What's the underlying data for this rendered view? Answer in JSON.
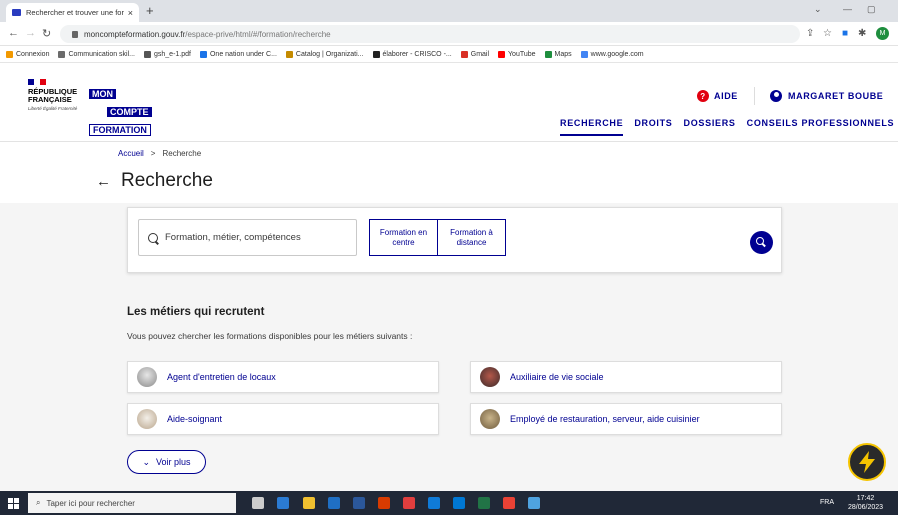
{
  "browser": {
    "tab_title": "Rechercher et trouver une forma",
    "tab_close": "×",
    "new_tab": "+",
    "url_host": "moncompteformation.gouv.fr",
    "url_path": "/espace-prive/html/#/formation/recherche",
    "profile_initial": "M",
    "bookmarks": [
      {
        "label": "Connexion",
        "color": "#f29900"
      },
      {
        "label": "Communication skil...",
        "color": "#6b6b6b"
      },
      {
        "label": "gsh_e-1.pdf",
        "color": "#555555"
      },
      {
        "label": "One nation under C...",
        "color": "#1a73e8"
      },
      {
        "label": "Catalog | Organizati...",
        "color": "#c58b00"
      },
      {
        "label": "élaborer - CRISCO -...",
        "color": "#222222"
      },
      {
        "label": "Gmail",
        "color": "#d93025"
      },
      {
        "label": "YouTube",
        "color": "#ff0000"
      },
      {
        "label": "Maps",
        "color": "#1e8e3e"
      },
      {
        "label": "www.google.com",
        "color": "#4285f4"
      }
    ]
  },
  "header": {
    "rf_line1": "RÉPUBLIQUE",
    "rf_line2": "FRANÇAISE",
    "rf_motto": "Liberté Égalité Fraternité",
    "mcf_line1": "MON",
    "mcf_line2": "COMPTE",
    "mcf_line3": "FORMATION",
    "aide_label": "AIDE",
    "user_label": "MARGARET BOUBE",
    "nav": [
      "RECHERCHE",
      "DROITS",
      "DOSSIERS",
      "CONSEILS PROFESSIONNELS"
    ]
  },
  "breadcrumb": {
    "home": "Accueil",
    "sep": ">",
    "current": "Recherche"
  },
  "page": {
    "back": "←",
    "title": "Recherche"
  },
  "search": {
    "placeholder": "Formation, métier, compétences",
    "option1": "Formation en centre",
    "option2": "Formation à distance"
  },
  "jobs_section": {
    "title": "Les métiers qui recrutent",
    "subtitle": "Vous pouvez chercher les formations disponibles pour les métiers suivants :",
    "jobs": [
      "Agent d'entretien de locaux",
      "Auxiliaire de vie sociale",
      "Aide-soignant",
      "Employé de restauration, serveur, aide cuisinier"
    ],
    "more_label": "Voir plus"
  },
  "taskbar": {
    "search_placeholder": "Taper ici pour rechercher",
    "lang": "FRA",
    "time": "17:42",
    "date": "28/06/2023"
  }
}
